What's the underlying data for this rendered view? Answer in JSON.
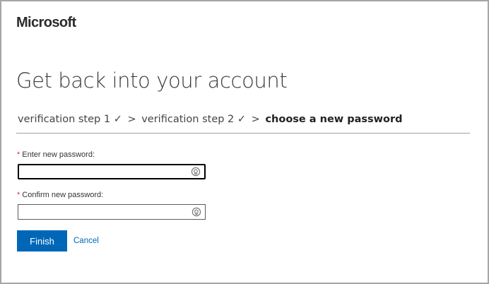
{
  "brand": {
    "logo_text": "Microsoft"
  },
  "page": {
    "title": "Get back into your account"
  },
  "breadcrumb": {
    "steps": [
      {
        "label": "verification step 1",
        "check": "✓"
      },
      {
        "label": "verification step 2",
        "check": "✓"
      }
    ],
    "separator": ">",
    "current": "choose a new password"
  },
  "form": {
    "new_password": {
      "required_marker": "*",
      "label": "Enter new password:",
      "value": "",
      "focused": true,
      "reveal_icon": "password-reveal-icon"
    },
    "confirm_password": {
      "required_marker": "*",
      "label": "Confirm new password:",
      "value": "",
      "focused": false,
      "reveal_icon": "password-reveal-icon"
    }
  },
  "actions": {
    "finish_label": "Finish",
    "cancel_label": "Cancel"
  },
  "colors": {
    "accent": "#0067b8",
    "required": "#d13438",
    "frame_border": "#a6a6a6"
  }
}
